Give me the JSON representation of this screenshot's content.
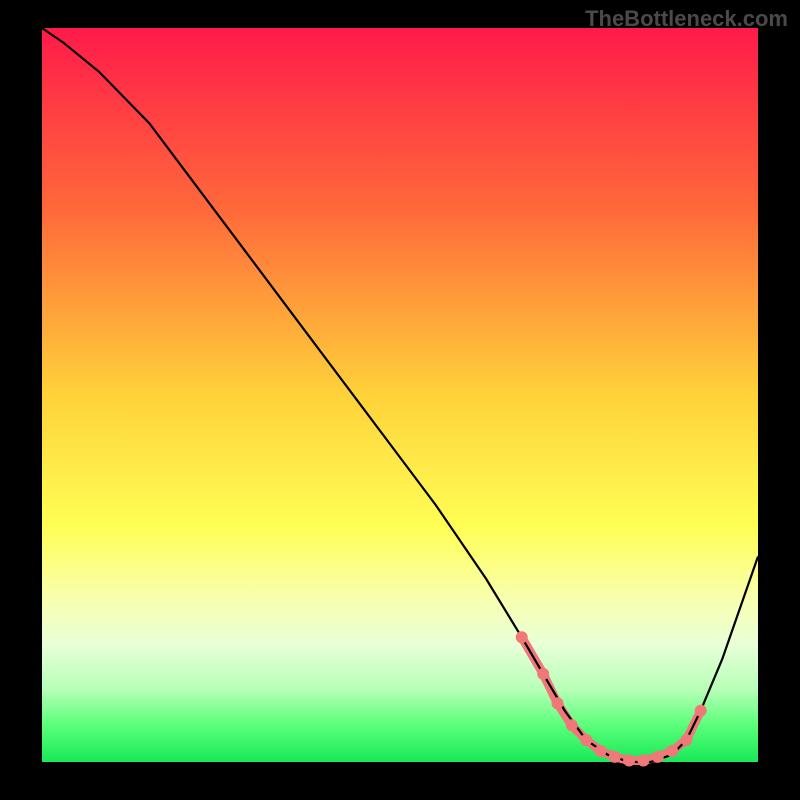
{
  "watermark": "TheBottleneck.com",
  "chart_data": {
    "type": "line",
    "title": "",
    "xlabel": "",
    "ylabel": "",
    "xlim": [
      0,
      100
    ],
    "ylim": [
      0,
      100
    ],
    "background_gradient_stops": [
      {
        "offset": 0,
        "color": "#ff1a4a"
      },
      {
        "offset": 25,
        "color": "#ff6a3a"
      },
      {
        "offset": 50,
        "color": "#ffd23a"
      },
      {
        "offset": 68,
        "color": "#ffff55"
      },
      {
        "offset": 78,
        "color": "#f8ffb0"
      },
      {
        "offset": 84,
        "color": "#e8ffd8"
      },
      {
        "offset": 90,
        "color": "#b8ffb8"
      },
      {
        "offset": 95,
        "color": "#5aff7a"
      },
      {
        "offset": 100,
        "color": "#18e858"
      }
    ],
    "series": [
      {
        "name": "bottleneck-curve",
        "color": "#000000",
        "x": [
          0,
          3,
          8,
          15,
          25,
          35,
          45,
          55,
          62,
          67,
          70,
          73,
          76,
          79,
          82,
          85,
          88,
          90,
          92,
          95,
          100
        ],
        "y": [
          100,
          98,
          94,
          87,
          74,
          61,
          48,
          35,
          25,
          17,
          12,
          7,
          3,
          1,
          0,
          0,
          1,
          3,
          7,
          14,
          28
        ]
      }
    ],
    "markers": {
      "name": "highlight-dots",
      "color": "#f07878",
      "x": [
        67,
        70,
        72,
        74,
        76,
        78,
        80,
        82,
        84,
        86,
        88,
        90,
        92
      ],
      "y": [
        17,
        12,
        8,
        5,
        3,
        1.5,
        0.7,
        0.2,
        0.2,
        0.7,
        1.5,
        3,
        7
      ]
    }
  }
}
